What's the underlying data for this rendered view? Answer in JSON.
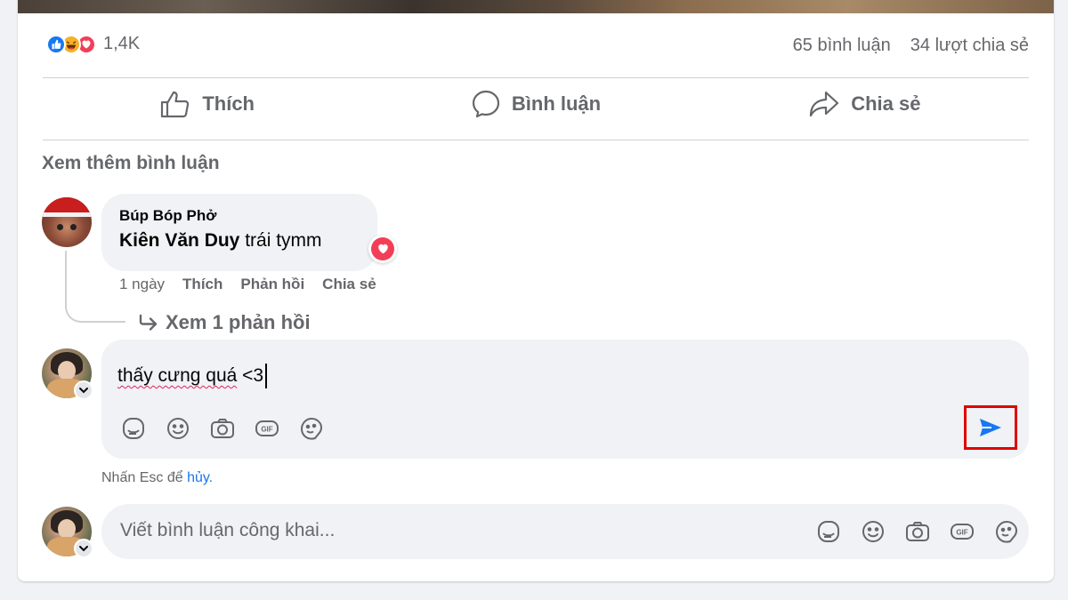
{
  "reactions": {
    "icons": [
      "like-icon",
      "haha-icon",
      "love-icon"
    ],
    "count": "1,4K"
  },
  "stats": {
    "comments": "65 bình luận",
    "shares": "34 lượt chia sẻ"
  },
  "actions": {
    "like": "Thích",
    "comment": "Bình luận",
    "share": "Chia sẻ"
  },
  "comments": {
    "see_more": "Xem thêm bình luận",
    "items": [
      {
        "author": "Búp Bóp Phở",
        "mention": "Kiên Văn Duy",
        "text": " trái tymm",
        "reaction": "love-icon",
        "time": "1 ngày",
        "like": "Thích",
        "reply": "Phản hồi",
        "share": "Chia sẻ",
        "view_replies": "Xem 1 phản hồi"
      }
    ]
  },
  "reply_composer": {
    "value_underlined": "thấy cưng quá",
    "value_rest": " <3",
    "tools": [
      "sticker-icon",
      "emoji-icon",
      "camera-icon",
      "gif-icon",
      "avatar-sticker-icon"
    ],
    "send_icon": "send-icon",
    "hint_prefix": "Nhấn Esc để ",
    "hint_cancel": "hủy."
  },
  "main_composer": {
    "placeholder": "Viết bình luận công khai...",
    "tools": [
      "sticker-icon",
      "emoji-icon",
      "camera-icon",
      "gif-icon",
      "avatar-sticker-icon"
    ]
  },
  "colors": {
    "accent": "#1877f2",
    "love": "#f33e58",
    "highlight": "#e00000"
  }
}
